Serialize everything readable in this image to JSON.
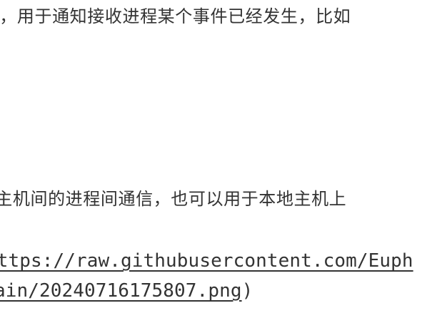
{
  "document": {
    "paragraph_1_fragment": "l，用于通知接收进程某个事件已经发生，比如",
    "paragraph_2_fragment": "l主机间的进程间通信，也可以用于本地主机上",
    "image_link": {
      "line_1": "https://raw.githubusercontent.com/Euph",
      "line_2": "ain/20240716175807.png",
      "closing_paren": ")"
    }
  }
}
